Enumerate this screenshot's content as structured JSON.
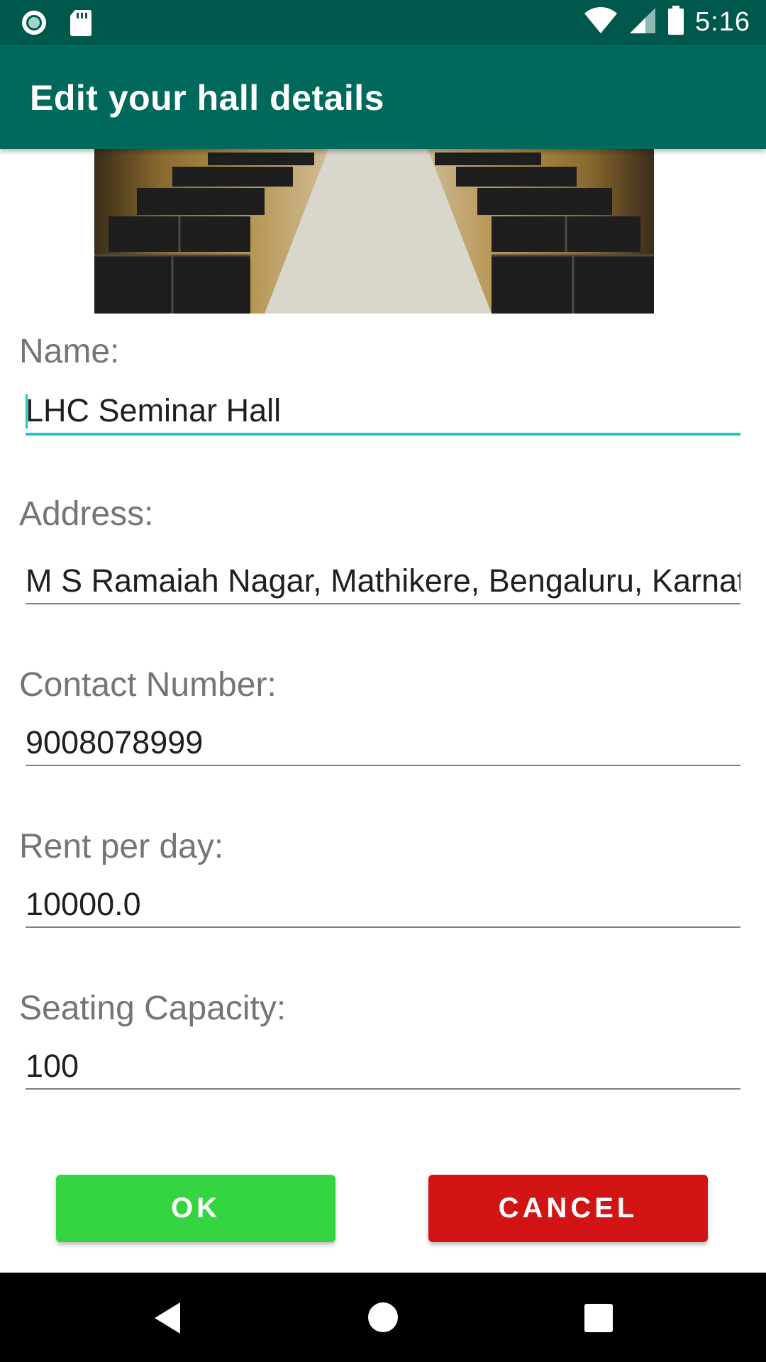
{
  "status_bar": {
    "time": "5:16",
    "icons": [
      "circle-notification-icon",
      "sd-card-icon",
      "wifi-icon",
      "cell-signal-icon",
      "battery-icon"
    ]
  },
  "app_bar": {
    "title": "Edit your hall details",
    "color": "#00695c"
  },
  "hero_image": {
    "description_icon": "hall-photo"
  },
  "form": {
    "name": {
      "label": "Name:",
      "value": "LHC Seminar Hall"
    },
    "address": {
      "label": "Address:",
      "value": "M S Ramaiah Nagar, Mathikere, Bengaluru, Karnataka"
    },
    "contact": {
      "label": "Contact Number:",
      "value": "9008078999"
    },
    "rent": {
      "label": "Rent per day:",
      "value": "10000.0"
    },
    "capacity": {
      "label": "Seating Capacity:",
      "value": "100"
    }
  },
  "buttons": {
    "ok_label": "OK",
    "cancel_label": "CANCEL",
    "ok_color": "#35d542",
    "cancel_color": "#d21414"
  },
  "nav_bar": {
    "icons": [
      "back-icon",
      "home-icon",
      "recents-icon"
    ]
  }
}
